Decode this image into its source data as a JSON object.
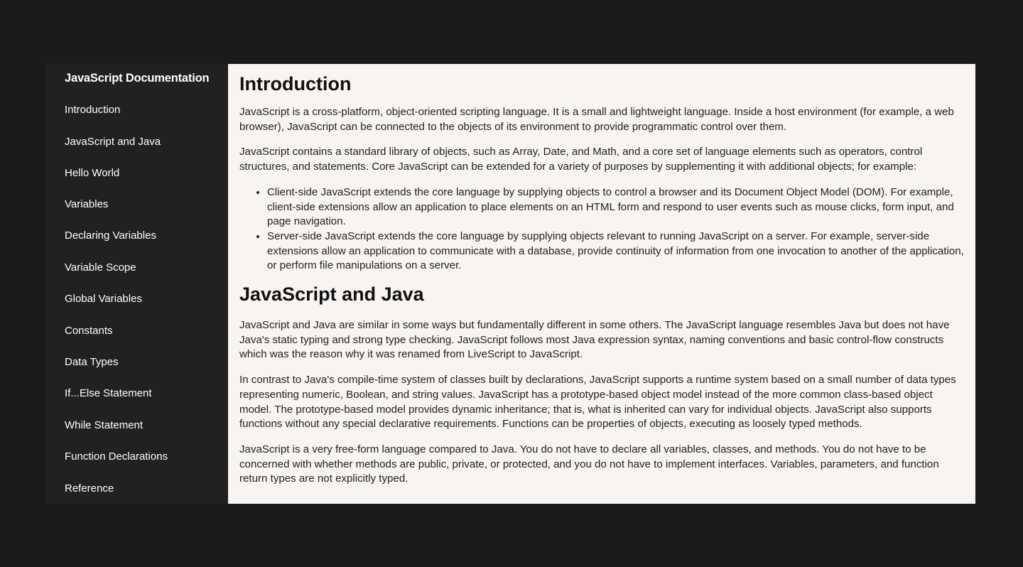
{
  "nav": {
    "title": "JavaScript Documentation",
    "items": [
      "Introduction",
      "JavaScript and Java",
      "Hello World",
      "Variables",
      "Declaring Variables",
      "Variable Scope",
      "Global Variables",
      "Constants",
      "Data Types",
      "If...Else Statement",
      "While Statement",
      "Function Declarations",
      "Reference"
    ]
  },
  "sections": [
    {
      "heading": "Introduction",
      "p1": "JavaScript is a cross-platform, object-oriented scripting language. It is a small and lightweight language. Inside a host environment (for example, a web browser), JavaScript can be connected to the objects of its environment to provide programmatic control over them.",
      "p2": "JavaScript contains a standard library of objects, such as Array, Date, and Math, and a core set of language elements such as operators, control structures, and statements. Core JavaScript can be extended for a variety of purposes by supplementing it with additional objects; for example:",
      "list": [
        "Client-side JavaScript extends the core language by supplying objects to control a browser and its Document Object Model (DOM). For example, client-side extensions allow an application to place elements on an HTML form and respond to user events such as mouse clicks, form input, and page navigation.",
        "Server-side JavaScript extends the core language by supplying objects relevant to running JavaScript on a server. For example, server-side extensions allow an application to communicate with a database, provide continuity of information from one invocation to another of the application, or perform file manipulations on a server."
      ]
    },
    {
      "heading": "JavaScript and Java",
      "p1": "JavaScript and Java are similar in some ways but fundamentally different in some others. The JavaScript language resembles Java but does not have Java's static typing and strong type checking. JavaScript follows most Java expression syntax, naming conventions and basic control-flow constructs which was the reason why it was renamed from LiveScript to JavaScript.",
      "p2": "In contrast to Java's compile-time system of classes built by declarations, JavaScript supports a runtime system based on a small number of data types representing numeric, Boolean, and string values. JavaScript has a prototype-based object model instead of the more common class-based object model. The prototype-based model provides dynamic inheritance; that is, what is inherited can vary for individual objects. JavaScript also supports functions without any special declarative requirements. Functions can be properties of objects, executing as loosely typed methods.",
      "p3": "JavaScript is a very free-form language compared to Java. You do not have to declare all variables, classes, and methods. You do not have to be concerned with whether methods are public, private, or protected, and you do not have to implement interfaces. Variables, parameters, and function return types are not explicitly typed."
    }
  ]
}
